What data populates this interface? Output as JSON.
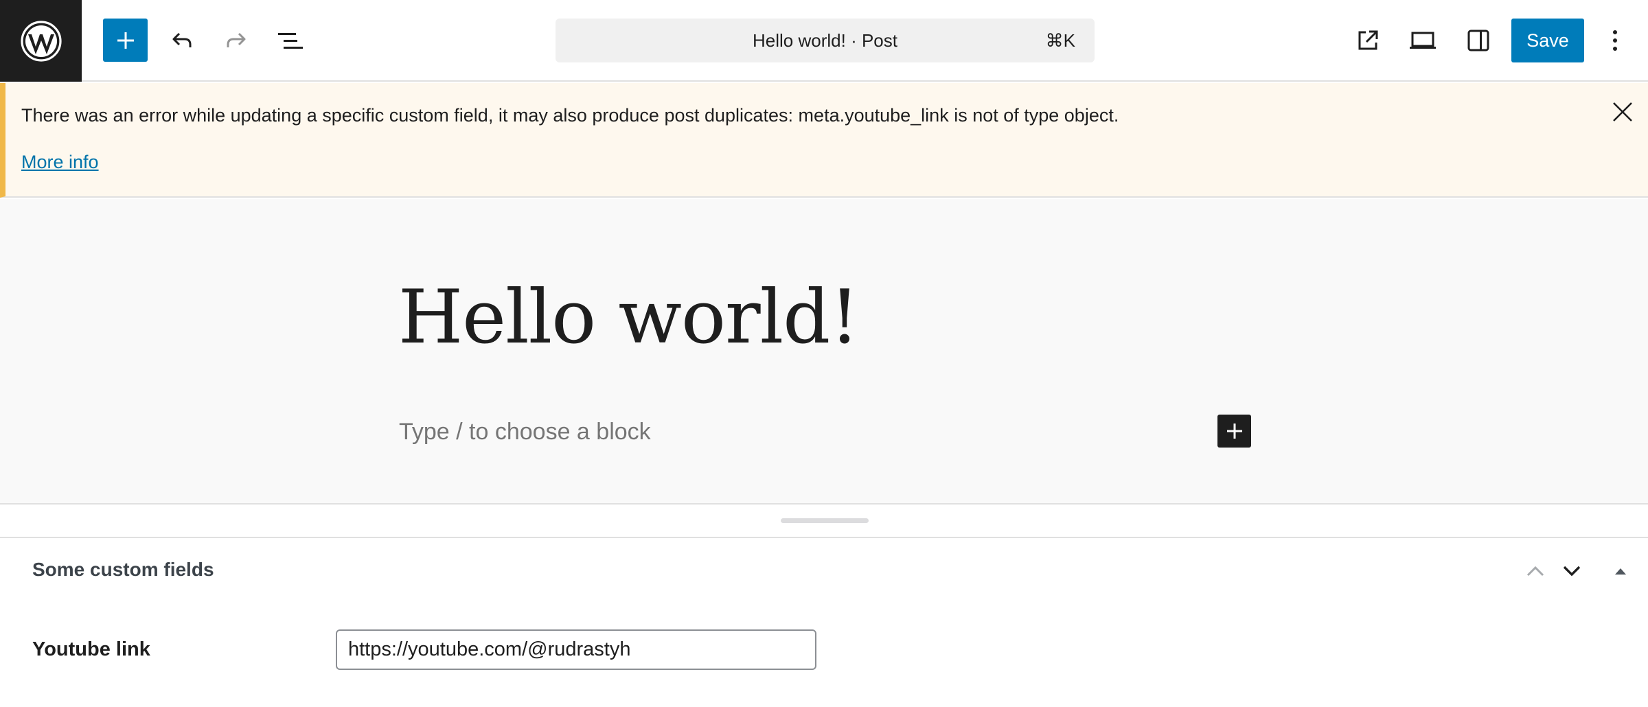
{
  "header": {
    "logo_icon": "wordpress-logo-icon",
    "inserter_icon": "plus-icon",
    "undo_icon": "undo-icon",
    "redo_icon": "redo-icon",
    "document_overview_icon": "list-view-icon",
    "command_bar": {
      "title": "Hello world! · Post",
      "shortcut": "⌘K"
    },
    "view_post_icon": "external-link-icon",
    "preview_icon": "desktop-preview-icon",
    "settings_icon": "sidebar-toggle-icon",
    "save_label": "Save",
    "options_icon": "more-vertical-icon"
  },
  "notice": {
    "message": "There was an error while updating a specific custom field, it may also produce post duplicates: meta.youtube_link is not of type object.",
    "link_label": "More info",
    "close_icon": "close-icon"
  },
  "editor": {
    "post_title": "Hello world!",
    "block_placeholder": "Type / to choose a block",
    "block_add_icon": "plus-icon"
  },
  "metabox": {
    "title": "Some custom fields",
    "move_up_icon": "chevron-up-icon",
    "move_down_icon": "chevron-down-icon",
    "toggle_icon": "triangle-up-icon",
    "fields": [
      {
        "label": "Youtube link",
        "value": "https://youtube.com/@rudrastyh"
      }
    ]
  },
  "colors": {
    "accent": "#007cba",
    "notice_border": "#f0b849",
    "notice_background": "#fef8ee",
    "dark": "#1e1e1e"
  }
}
